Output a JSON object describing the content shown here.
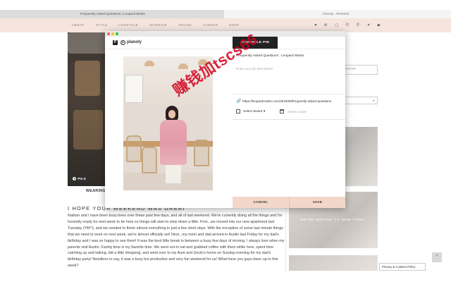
{
  "browser": {
    "active_tab": "Frequently Asked Questions | Leopard Martin",
    "inactive_tab": "Planoly - Pinterest"
  },
  "nav": {
    "items": [
      "ABOUT",
      "STYLE",
      "LIFESTYLE",
      "INTERIOR",
      "TRAVEL",
      "CAREER",
      "SHOP"
    ],
    "social_icons": [
      "heart-icon",
      "mail-icon",
      "instagram-icon",
      "pinterest-icon",
      "pinterest-icon",
      "twitter-icon",
      "youtube-icon"
    ]
  },
  "page": {
    "hero_pin_it": "Pin It",
    "wearing_label": "WEARING",
    "post_heading": "I HOPE YOUR WEEKEND WAS GREAT",
    "post_body": "Nathan and I have been busy bees over these past few days, and all of last weekend. We're currently doing all the things and I'm honestly ready for next week to be here so things will start to slow down a little. First...we moved into our new apartment last Tuesday (YAY!), and we needed to finish almost everything in just a few short days. With the exception of some last minute things that we need to work on next week, we're almost officially set! Next...my mom and dad arrived in Austin last Friday for my dad's birthday and I was so happy to see them! It was the best little break in between a busy few days of moving. I always love when my parents visit Austin. Family time is my favorite time. We went out to eat and grabbed coffee with them while here, spent time catching up and talking, did a little shopping, and went over to my Aunt and Uncle's home on Sunday evening for my dad's birthday party! Needless to say, it was a busy but productive and very fun weekend for us! What have you guys been up to this week?"
  },
  "sidebar": {
    "newsletter_placeholder": "ENTER",
    "select_arrow": "▾",
    "label": "",
    "thumb2_caption": "WE'RE MOVING TO NEW YORK!"
  },
  "footer": {
    "privacy_label": "Privacy & Cookies Policy",
    "scroll_top": "^"
  },
  "modal": {
    "logo": "P",
    "brand_p": "p",
    "brand_name": "planoly",
    "schedule_button": "SCHEDULE PIN",
    "pin_title": "Frequently Asked Questions : Leopard Martin",
    "pin_description_placeholder": "Enter your pin description",
    "pin_link": "https://leopardmartin.com/2019/08/frequently-asked-questions",
    "board_select": "Select Board",
    "board_arrow": "▾",
    "date_placeholder": "Select a date",
    "cancel_button": "CANCEL",
    "save_button": "SAVE",
    "link_icon": "🔗"
  },
  "watermark": "赚钱加tscs66",
  "colors": {
    "nav_bg": "#f5e5de",
    "footer_bar": "#f3d7c9",
    "schedule_btn": "#222222",
    "watermark": "#d1001c"
  }
}
